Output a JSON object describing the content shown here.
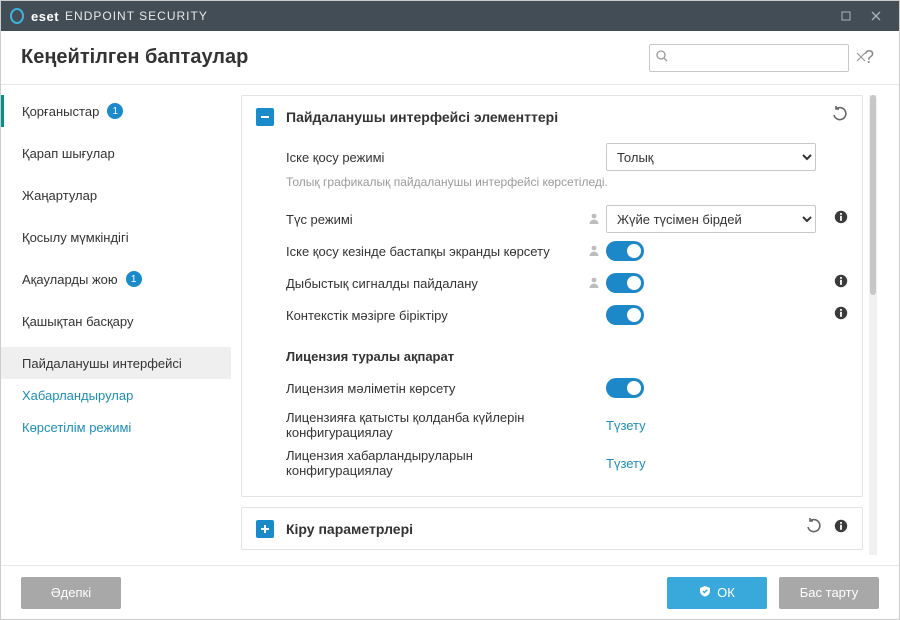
{
  "titlebar": {
    "brand": "eset",
    "product": "ENDPOINT SECURITY"
  },
  "header": {
    "title": "Кеңейтілген баптаулар",
    "search_placeholder": ""
  },
  "sidebar": {
    "items": [
      {
        "label": "Қорғаныстар",
        "badge": "1"
      },
      {
        "label": "Қарап шығулар"
      },
      {
        "label": "Жаңартулар"
      },
      {
        "label": "Қосылу мүмкіндігі"
      },
      {
        "label": "Ақауларды жою",
        "badge": "1"
      },
      {
        "label": "Қашықтан басқару"
      }
    ],
    "subitems": [
      {
        "label": "Пайдаланушы интерфейсі"
      },
      {
        "label": "Хабарландырулар"
      },
      {
        "label": "Көрсетілім режимі"
      }
    ]
  },
  "panel1": {
    "title": "Пайдаланушы интерфейсі элементтері",
    "rows": {
      "startup_mode": {
        "label": "Іске қосу режимі",
        "value": "Толық"
      },
      "startup_help": "Толық графикалық пайдаланушы интерфейсі көрсетіледі.",
      "theme": {
        "label": "Түс режимі",
        "value": "Жүйе түсімен бірдей"
      },
      "splash": {
        "label": "Іске қосу кезінде бастапқы экранды көрсету"
      },
      "sound": {
        "label": "Дыбыстық сигналды пайдалану"
      },
      "context": {
        "label": "Контекстік мәзірге біріктіру"
      }
    },
    "license_section": "Лицензия туралы ақпарат",
    "license_rows": {
      "show_info": {
        "label": "Лицензия мәліметін көрсету"
      },
      "app_states": {
        "label": "Лицензияға қатысты қолданба күйлерін конфигурациялау",
        "link": "Түзету"
      },
      "notifications": {
        "label": "Лицензия хабарландыруларын конфигурациялау",
        "link": "Түзету"
      }
    }
  },
  "panel2": {
    "title": "Кіру параметрлері"
  },
  "footer": {
    "default": "Әдепкі",
    "ok": "ОК",
    "cancel": "Бас тарту"
  }
}
